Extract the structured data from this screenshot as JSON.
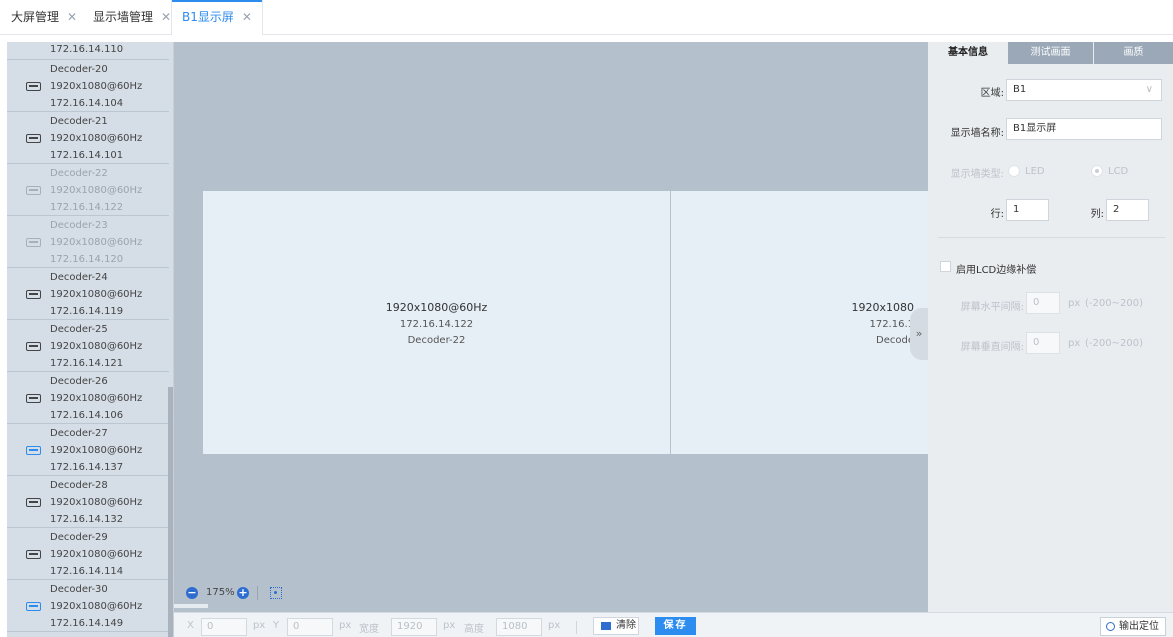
{
  "tabs": [
    {
      "label": "大屏管理",
      "close": "✕"
    },
    {
      "label": "显示墙管理",
      "close": "✕"
    },
    {
      "label": "B1显示屏",
      "close": "✕"
    }
  ],
  "decoder_list": [
    {
      "name": "",
      "resolution": "",
      "ip": "172.16.14.110",
      "state": "normal"
    },
    {
      "name": "Decoder-20",
      "resolution": "1920x1080@60Hz",
      "ip": "172.16.14.104",
      "state": "normal"
    },
    {
      "name": "Decoder-21",
      "resolution": "1920x1080@60Hz",
      "ip": "172.16.14.101",
      "state": "normal"
    },
    {
      "name": "Decoder-22",
      "resolution": "1920x1080@60Hz",
      "ip": "172.16.14.122",
      "state": "disabled"
    },
    {
      "name": "Decoder-23",
      "resolution": "1920x1080@60Hz",
      "ip": "172.16.14.120",
      "state": "disabled"
    },
    {
      "name": "Decoder-24",
      "resolution": "1920x1080@60Hz",
      "ip": "172.16.14.119",
      "state": "normal"
    },
    {
      "name": "Decoder-25",
      "resolution": "1920x1080@60Hz",
      "ip": "172.16.14.121",
      "state": "normal"
    },
    {
      "name": "Decoder-26",
      "resolution": "1920x1080@60Hz",
      "ip": "172.16.14.106",
      "state": "normal"
    },
    {
      "name": "Decoder-27",
      "resolution": "1920x1080@60Hz",
      "ip": "172.16.14.137",
      "state": "active"
    },
    {
      "name": "Decoder-28",
      "resolution": "1920x1080@60Hz",
      "ip": "172.16.14.132",
      "state": "normal"
    },
    {
      "name": "Decoder-29",
      "resolution": "1920x1080@60Hz",
      "ip": "172.16.14.114",
      "state": "normal"
    },
    {
      "name": "Decoder-30",
      "resolution": "1920x1080@60Hz",
      "ip": "172.16.14.149",
      "state": "active"
    }
  ],
  "screens": [
    {
      "resolution": "1920x1080@60Hz",
      "ip": "172.16.14.122",
      "decoder": "Decoder-22"
    },
    {
      "resolution": "1920x1080",
      "ip": "172.16.1",
      "decoder": "Decode"
    }
  ],
  "canvas": {
    "collapse_glyph": "»",
    "zoom_minus": "−",
    "zoom_level": "175%",
    "zoom_plus": "+"
  },
  "bottom": {
    "x_label": "X",
    "x_value": "0",
    "y_label": "Y",
    "y_value": "0",
    "width_label": "宽度",
    "width_value": "1920",
    "height_label": "高度",
    "height_value": "1080",
    "unit": "px",
    "clear_label": "清除",
    "save_label": "保存",
    "locate_label": "输出定位"
  },
  "right_panel": {
    "tabs": [
      "基本信息",
      "测试画面",
      "画质"
    ],
    "region_label": "区域:",
    "region_value": "B1",
    "region_chevron": "∨",
    "name_label": "显示墙名称:",
    "name_value": "B1显示屏",
    "type_label": "显示墙类型:",
    "type_led": "LED",
    "type_lcd": "LCD",
    "rows_label": "行:",
    "rows_value": "1",
    "cols_label": "列:",
    "cols_value": "2",
    "bezel_label": "启用LCD边缘补偿",
    "h_gap_label": "屏幕水平间隔:",
    "h_gap_value": "0",
    "v_gap_label": "屏幕垂直间隔:",
    "v_gap_value": "0",
    "gap_unit": "px",
    "gap_range": "(-200~200)"
  },
  "colors": {
    "accent": "#2d8cf0",
    "canvas_bg": "#b5c0cd",
    "list_bg": "#d5dde6",
    "screen_bg": "#e6eef6"
  }
}
